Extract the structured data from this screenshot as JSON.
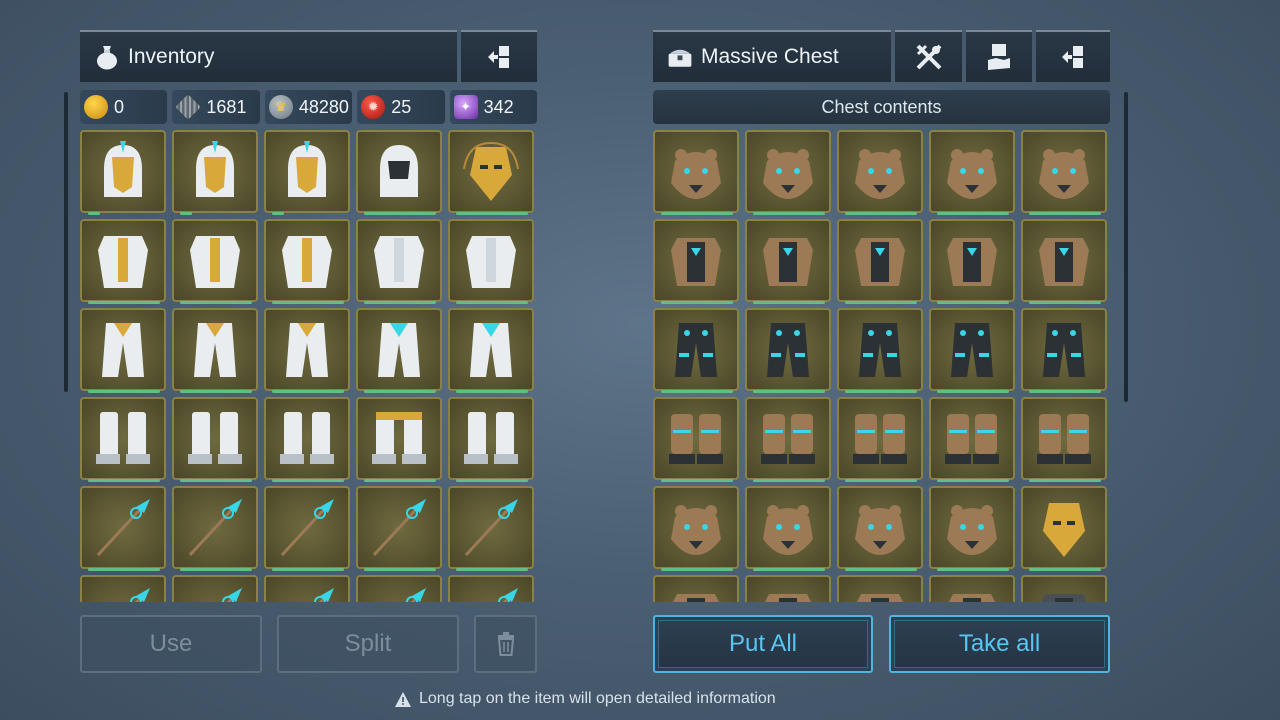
{
  "inventory": {
    "title": "Inventory",
    "currencies": [
      {
        "icon": "gold-coin-icon",
        "value": "0"
      },
      {
        "icon": "metal-ingot-icon",
        "value": "1681"
      },
      {
        "icon": "crown-coin-icon",
        "value": "48280"
      },
      {
        "icon": "red-token-icon",
        "value": "25"
      },
      {
        "icon": "purple-crystal-icon",
        "value": "342"
      }
    ],
    "rows": [
      [
        "golden-helmet",
        "golden-helmet",
        "golden-helmet",
        "white-hood",
        "horned-gold-mask"
      ],
      [
        "white-gold-armor",
        "white-gold-armor",
        "white-gold-armor",
        "white-coat",
        "white-robe"
      ],
      [
        "white-gold-pants",
        "white-gold-pants",
        "white-gold-pants",
        "white-pants",
        "white-robe-pants"
      ],
      [
        "white-boots",
        "white-boots",
        "white-boots",
        "gold-cuff-boots",
        "white-tall-boots"
      ],
      [
        "cyan-spear",
        "cyan-spear",
        "cyan-spear",
        "cyan-spear",
        "cyan-spear"
      ],
      [
        "cyan-spear",
        "cyan-spear",
        "cyan-spear",
        "cyan-spear",
        "cyan-spear"
      ]
    ],
    "buttons": {
      "use": "Use",
      "split": "Split"
    }
  },
  "chest": {
    "title": "Massive Chest",
    "contents_label": "Chest contents",
    "rows": [
      [
        "bear-helmet",
        "bear-helmet",
        "bear-helmet",
        "bear-helmet",
        "bear-helmet"
      ],
      [
        "bear-armor",
        "bear-armor",
        "bear-armor",
        "bear-armor",
        "bear-armor"
      ],
      [
        "bear-pants",
        "bear-pants",
        "bear-pants",
        "bear-pants",
        "bear-pants"
      ],
      [
        "bear-boots",
        "bear-boots",
        "bear-boots",
        "bear-boots",
        "bear-boots"
      ],
      [
        "bear-helmet",
        "bear-helmet",
        "bear-helmet",
        "bear-helmet",
        "gold-mask"
      ],
      [
        "bear-armor",
        "bear-armor",
        "bear-armor",
        "bear-armor",
        "dark-armor"
      ]
    ],
    "buttons": {
      "put_all": "Put All",
      "take_all": "Take all"
    }
  },
  "hint": "Long tap on the item will open detailed information",
  "colors": {
    "accent": "#58c6f2",
    "slot_gold": "#8a8245",
    "durability": "#5fbf86"
  }
}
